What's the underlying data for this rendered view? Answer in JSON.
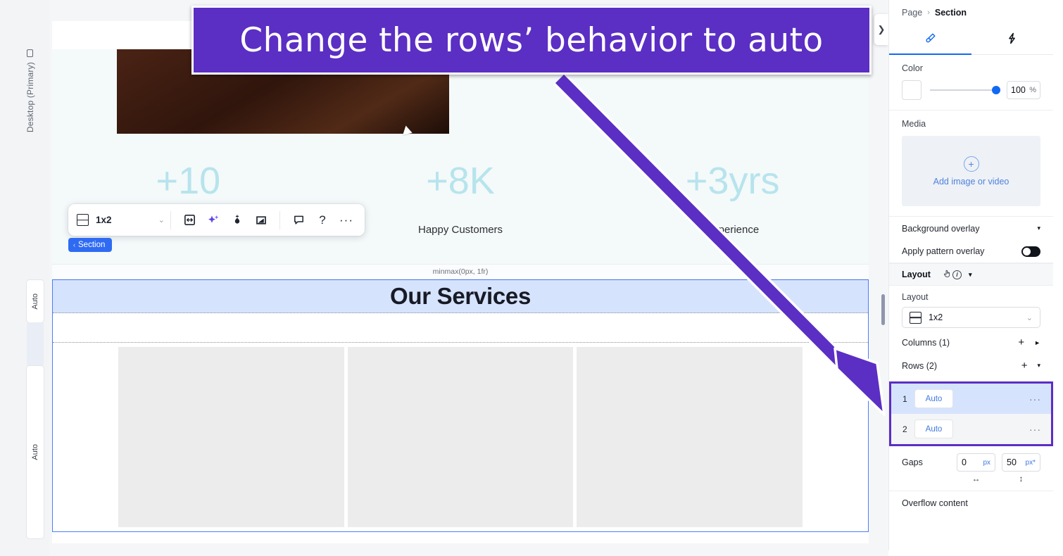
{
  "annotation": {
    "banner_text": "Change the rows’ behavior to auto",
    "banner_color": "#5b2ec4",
    "arrow_color": "#5b2ec4"
  },
  "left_rail": {
    "device_label": "Desktop (Primary)",
    "device_icon": "monitor-icon",
    "row_handles": [
      {
        "label": "Auto"
      },
      {
        "label": "Auto"
      }
    ]
  },
  "canvas": {
    "collapse_icon": "chevron-right-icon",
    "track_label": "minmax(0px, 1fr)",
    "stats": [
      {
        "value": "+10",
        "label": ""
      },
      {
        "value": "+8K",
        "label": "Happy Customers"
      },
      {
        "value": "+3yrs",
        "label": "Experience"
      }
    ],
    "section_heading": "Our Services",
    "section_badge": "Section",
    "section_badge_caret": "‹"
  },
  "toolbar": {
    "layout_icon": "grid-1x2-icon",
    "layout_value": "1x2",
    "layout_caret": "⌄",
    "icons": [
      {
        "name": "resize-horizontal-icon",
        "glyph": "↔"
      },
      {
        "name": "ai-sparkle-icon",
        "glyph": "✦"
      },
      {
        "name": "color-picker-icon",
        "glyph": "◉"
      },
      {
        "name": "corner-shape-icon",
        "glyph": "◣"
      },
      {
        "name": "comment-icon",
        "glyph": "🗨"
      },
      {
        "name": "help-icon",
        "glyph": "?"
      },
      {
        "name": "more-options-icon",
        "glyph": "···"
      }
    ]
  },
  "panel": {
    "breadcrumb": {
      "parent": "Page",
      "separator": "›",
      "current": "Section"
    },
    "tabs": [
      {
        "name": "design-tab",
        "icon": "paintbrush-icon",
        "active": true
      },
      {
        "name": "interactions-tab",
        "icon": "lightning-icon",
        "active": false
      }
    ],
    "color": {
      "label": "Color",
      "swatch": "#ffffff",
      "opacity_value": "100",
      "opacity_unit": "%"
    },
    "media": {
      "label": "Media",
      "cta": "Add image or video",
      "plus_icon": "plus-circle-icon"
    },
    "background_overlay": {
      "label": "Background overlay",
      "caret": "▾"
    },
    "pattern_overlay": {
      "label": "Apply pattern overlay",
      "enabled": false
    },
    "layout_section": {
      "title": "Layout",
      "cursor_icon": "hand-pointer-icon",
      "info_icon": "info-icon",
      "collapse_caret": "▾",
      "field_label": "Layout",
      "field_icon": "grid-1x2-icon",
      "field_value": "1x2",
      "field_caret": "⌄",
      "columns_label": "Columns (1)",
      "columns_add": "+",
      "columns_caret": "►",
      "rows_label": "Rows (2)",
      "rows_add": "+",
      "rows_caret": "▾",
      "rows": [
        {
          "index": "1",
          "value": "Auto",
          "menu": "···",
          "selected": true
        },
        {
          "index": "2",
          "value": "Auto",
          "menu": "···",
          "selected": false
        }
      ],
      "gaps_label": "Gaps",
      "gap_column": {
        "value": "0",
        "unit": "px",
        "icon": "↔"
      },
      "gap_row": {
        "value": "50",
        "unit": "px*",
        "icon": "↕"
      },
      "overflow_label": "Overflow content"
    }
  }
}
